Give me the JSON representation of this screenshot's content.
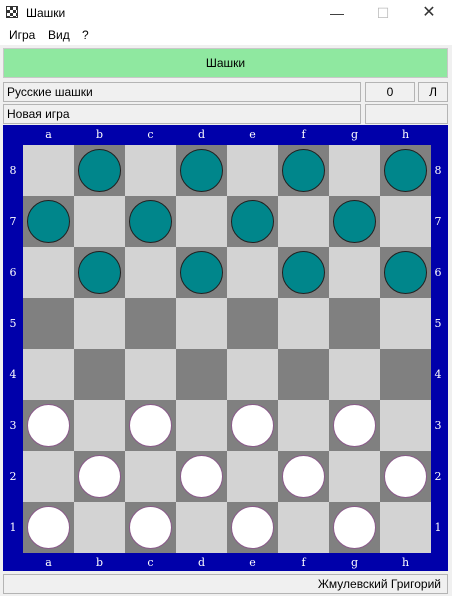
{
  "window": {
    "title": "Шашки",
    "minimize_glyph": "—",
    "maximize_glyph": "☐",
    "close_glyph": "✕"
  },
  "menu": [
    "Игра",
    "Вид",
    "?"
  ],
  "banner": "Шашки",
  "info": {
    "game_type": "Русские шашки",
    "counter": "0",
    "side": "Л",
    "status": "Новая игра",
    "status_extra": ""
  },
  "board": {
    "files": [
      "a",
      "b",
      "c",
      "d",
      "e",
      "f",
      "g",
      "h"
    ],
    "ranks": [
      "8",
      "7",
      "6",
      "5",
      "4",
      "3",
      "2",
      "1"
    ],
    "rows": [
      [
        "",
        "b",
        "",
        "b",
        "",
        "b",
        "",
        "b"
      ],
      [
        "b",
        "",
        "b",
        "",
        "b",
        "",
        "b",
        ""
      ],
      [
        "",
        "b",
        "",
        "b",
        "",
        "b",
        "",
        "b"
      ],
      [
        "",
        "",
        "",
        "",
        "",
        "",
        "",
        ""
      ],
      [
        "",
        "",
        "",
        "",
        "",
        "",
        "",
        ""
      ],
      [
        "w",
        "",
        "w",
        "",
        "w",
        "",
        "w",
        ""
      ],
      [
        "",
        "w",
        "",
        "w",
        "",
        "w",
        "",
        "w"
      ],
      [
        "w",
        "",
        "w",
        "",
        "w",
        "",
        "w",
        ""
      ]
    ],
    "colors": {
      "frame": "#0000aa",
      "light": "#d3d3d3",
      "dark": "#808080",
      "black_piece": "#00868b",
      "white_piece": "#ffffff"
    }
  },
  "footer": "Жмулевский Григорий"
}
